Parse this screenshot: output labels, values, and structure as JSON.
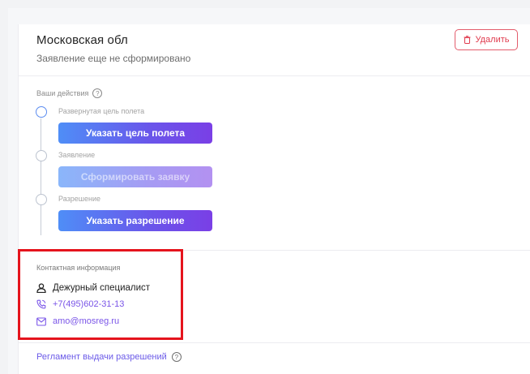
{
  "region": {
    "title": "Московская обл",
    "subtitle": "Заявление еще не сформировано"
  },
  "toolbar": {
    "delete_label": "Удалить"
  },
  "actions": {
    "label": "Ваши действия",
    "help": "?",
    "steps": [
      {
        "label": "Развернутая цель полета",
        "button": "Указать цель полета",
        "enabled": true
      },
      {
        "label": "Заявление",
        "button": "Сформировать заявку",
        "enabled": false
      },
      {
        "label": "Разрешение",
        "button": "Указать разрешение",
        "enabled": true
      }
    ]
  },
  "contact": {
    "label": "Контактная информация",
    "person": "Дежурный специалист",
    "phone": "+7(495)602-31-13",
    "email": "amo@mosreg.ru"
  },
  "regulations": {
    "link": "Регламент выдачи разрешений",
    "help": "?"
  },
  "colors": {
    "accent": "#6b5ae8",
    "danger": "#e03a4d",
    "highlight": "#e5141d",
    "button_start": "#4f8ef7",
    "button_end": "#7a3fe6"
  }
}
